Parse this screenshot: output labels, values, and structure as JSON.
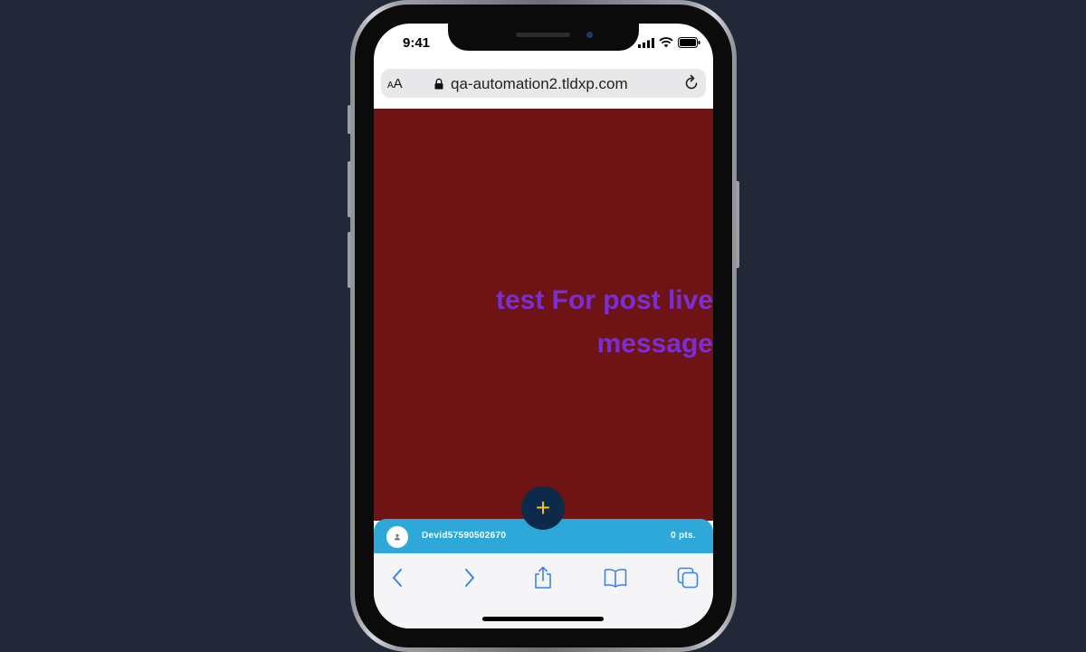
{
  "status_bar": {
    "time": "9:41"
  },
  "browser": {
    "text_size_label": "AA",
    "url": "qa-automation2.tldxp.com"
  },
  "page": {
    "background_color": "#6e1414",
    "message_text": "test For post live message",
    "message_color": "#7a2ed6",
    "add_button_label": "+"
  },
  "user_bar": {
    "username": "Devid57590502670",
    "points": "0 pts.",
    "bar_color": "#2ea8d9"
  },
  "toolbar": {
    "icons": [
      "back-icon",
      "forward-icon",
      "share-icon",
      "bookmarks-icon",
      "tabs-icon"
    ]
  }
}
